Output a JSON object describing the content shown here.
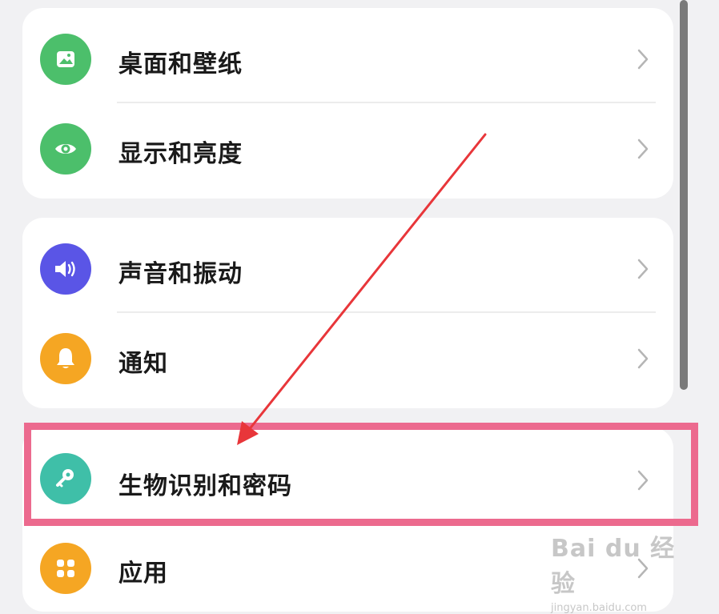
{
  "settings": {
    "groups": [
      {
        "items": [
          {
            "label": "桌面和壁纸",
            "icon": "wallpaper-icon",
            "color": "#4cbf6b"
          },
          {
            "label": "显示和亮度",
            "icon": "eye-icon",
            "color": "#4cbf6b"
          }
        ]
      },
      {
        "items": [
          {
            "label": "声音和振动",
            "icon": "speaker-icon",
            "color": "#5a55e6"
          },
          {
            "label": "通知",
            "icon": "bell-icon",
            "color": "#f5a623"
          }
        ]
      },
      {
        "items": [
          {
            "label": "生物识别和密码",
            "icon": "key-icon",
            "color": "#3fbfa8"
          },
          {
            "label": "应用",
            "icon": "apps-icon",
            "color": "#f5a623"
          }
        ]
      }
    ]
  },
  "annotation": {
    "highlight_color": "#ec6a8e",
    "arrow_color": "#e8363a"
  },
  "watermark": {
    "brand": "Bai du 经验",
    "url": "jingyan.baidu.com"
  }
}
